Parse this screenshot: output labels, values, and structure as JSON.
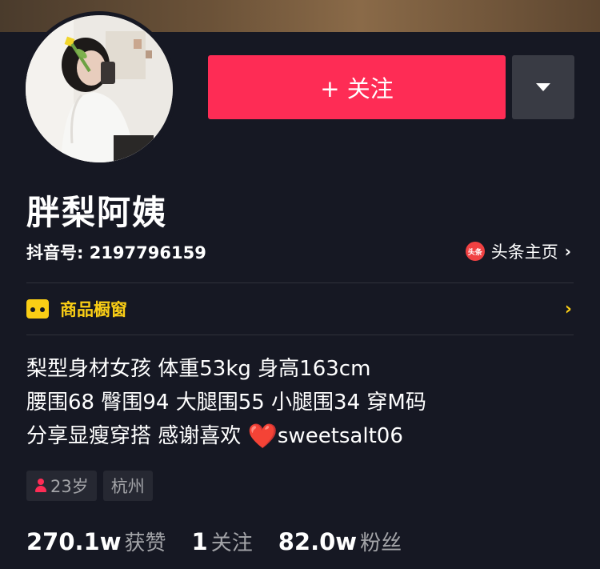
{
  "profile": {
    "nickname": "胖梨阿姨",
    "douyin_id": "抖音号: 2197796159",
    "follow_label": "+ 关注",
    "toutiao_logo_text": "头条",
    "toutiao_label": "头条主页",
    "chevron": "›"
  },
  "shop": {
    "label": "商品橱窗",
    "chevron": "›"
  },
  "bio": {
    "line1": "梨型身材女孩 体重53kg 身高163cm",
    "line2": "腰围68 臀围94 大腿围55 小腿围34  穿M码",
    "line3a": "分享显瘦穿搭  感谢喜欢 ",
    "heart": "❤️",
    "line3b": "sweetsalt06"
  },
  "tags": {
    "age": "23岁",
    "city": "杭州"
  },
  "stats": {
    "likes_num": "270.1w",
    "likes_label": "获赞",
    "following_num": "1",
    "following_label": "关注",
    "fans_num": "82.0w",
    "fans_label": "粉丝"
  },
  "colors": {
    "background": "#161823",
    "follow_button": "#fe2c55",
    "shop_accent": "#face15",
    "muted_text": "#a3a4a8"
  },
  "icons": [
    "caret-down-icon",
    "toutiao-logo-icon",
    "chevron-right-icon",
    "shop-icon",
    "person-icon",
    "heart-icon"
  ]
}
